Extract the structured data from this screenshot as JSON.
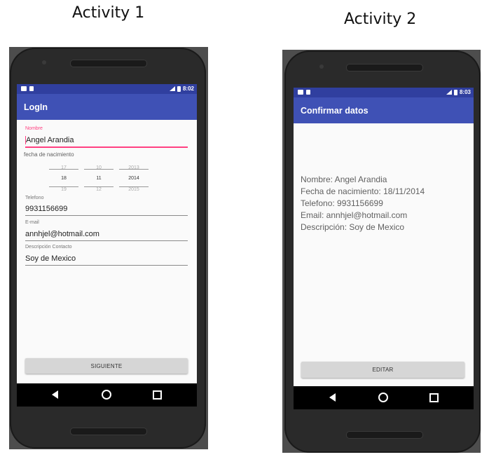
{
  "captions": {
    "activity1": "Activity 1",
    "activity2": "Activity 2"
  },
  "activity1": {
    "status_time": "8:02",
    "title": "LogIn",
    "nombre_label": "Nombre",
    "nombre_value": "Angel Arandia",
    "fecha_label": "fecha de nacimiento",
    "date_picker": {
      "prev": [
        "17",
        "10",
        "2013"
      ],
      "current": [
        "18",
        "11",
        "2014"
      ],
      "next": [
        "19",
        "12",
        "2015"
      ]
    },
    "telefono_label": "Telefono",
    "telefono_value": "9931156699",
    "email_label": "E-mail",
    "email_value": "annhjel@hotmail.com",
    "descripcion_label": "Descripción Contacto",
    "descripcion_value": "Soy de Mexico",
    "button_label": "SIGUIENTE"
  },
  "activity2": {
    "status_time": "8:03",
    "title": "Confirmar datos",
    "lines": [
      "Nombre: Angel Arandia",
      "Fecha de nacimiento: 18/11/2014",
      "Telefono: 9931156699",
      "Email: annhjel@hotmail.com",
      "Descripción: Soy de Mexico"
    ],
    "button_label": "EDITAR"
  },
  "colors": {
    "primary": "#3f51b5",
    "primary_dark": "#303f9f",
    "accent": "#ff4081"
  }
}
